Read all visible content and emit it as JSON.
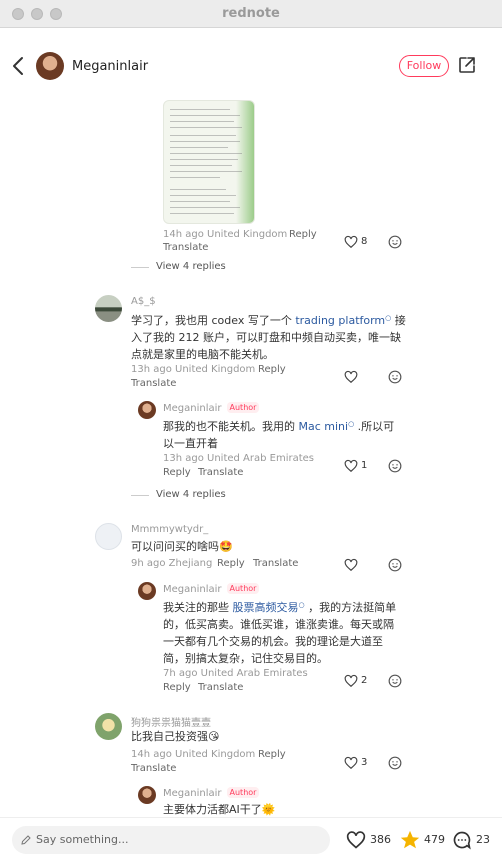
{
  "window": {
    "title": "rednote"
  },
  "header": {
    "author": "Meganinlair",
    "follow_label": "Follow"
  },
  "image_comment": {
    "time": "14h ago United Kingdom",
    "reply": "Reply",
    "translate": "Translate",
    "likes": "8",
    "view_replies": "View 4 replies"
  },
  "comment_a": {
    "user": "A$_$",
    "text_before": "学习了，我也用 codex 写了一个 ",
    "link": "trading platform",
    "text_after": " 接入了我的 212 账户，可以盯盘和中频自动买卖，唯一缺点就是家里的电脑不能关机。",
    "time": "13h ago United Kingdom",
    "reply": "Reply",
    "translate": "Translate",
    "reply_item": {
      "user": "Meganinlair",
      "badge": "Author",
      "text_before": "那我的也不能关机。我用的 ",
      "link": "Mac mini",
      "text_after": " .所以可以一直开着",
      "time": "13h ago United Arab Emirates",
      "reply": "Reply",
      "translate": "Translate",
      "likes": "1"
    },
    "view_replies": "View 4 replies"
  },
  "comment_b": {
    "user": "Mmmmywtydr_",
    "text": "可以问问买的啥吗🤩",
    "time": "9h ago Zhejiang",
    "reply": "Reply",
    "translate": "Translate",
    "reply_item": {
      "user": "Meganinlair",
      "badge": "Author",
      "text_before": "我关注的那些 ",
      "link": "股票高频交易",
      "text_after": " ，我的方法挺简单的，低买高卖。谁低买谁，谁涨卖谁。每天或隔一天都有几个交易的机会。我的理论是大道至简，别搞太复杂，记住交易目的。",
      "time": "7h ago United Arab Emirates",
      "reply": "Reply",
      "translate": "Translate",
      "likes": "2"
    }
  },
  "comment_c": {
    "user": "狗狗祟祟猫猫壹壹",
    "text": "比我自己投资强😘",
    "time": "14h ago United Kingdom",
    "reply": "Reply",
    "translate": "Translate",
    "likes": "3",
    "reply_item": {
      "user": "Meganinlair",
      "badge": "Author",
      "text": "主要体力活都AI干了🌞"
    }
  },
  "bottom_bar": {
    "placeholder": "Say something...",
    "likes": "386",
    "stars": "479",
    "comments": "23"
  },
  "colors": {
    "accent": "#ff3b5c",
    "link": "#2c5aa0",
    "star": "#f5b400"
  }
}
